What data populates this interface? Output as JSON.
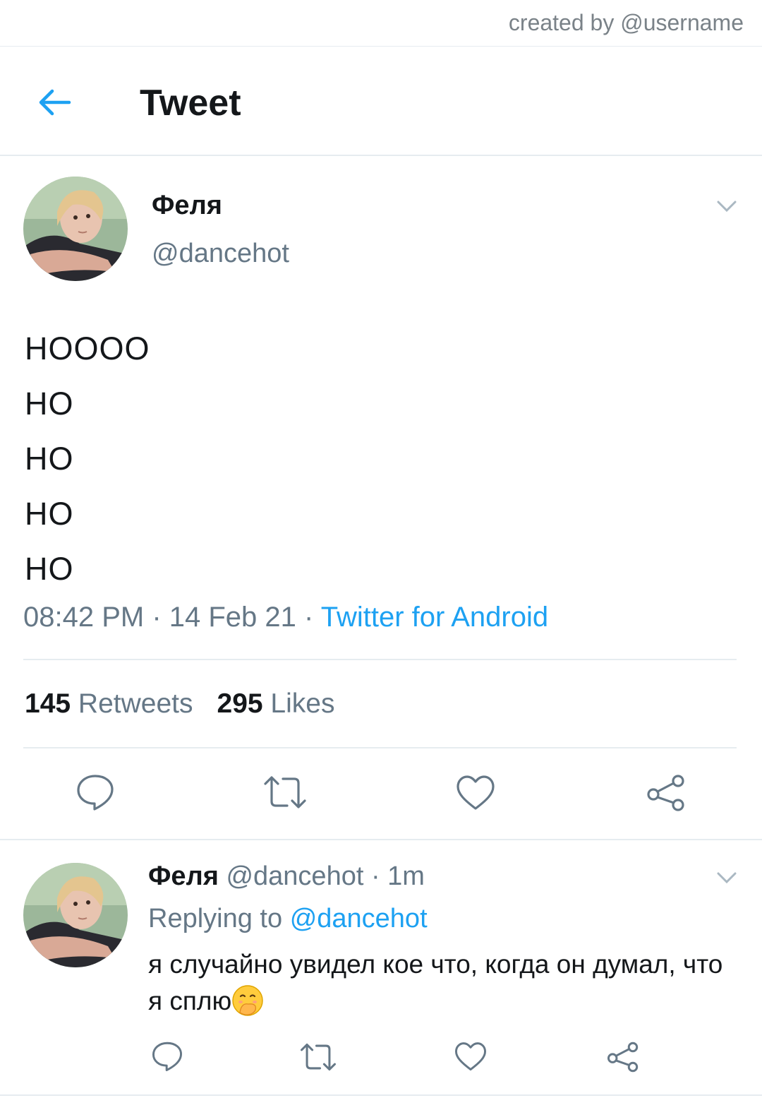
{
  "credit": "created by @username",
  "header": {
    "title": "Tweet",
    "back_icon": "arrow-left-icon",
    "accent": "#1da1f2"
  },
  "tweet": {
    "author_name": "Феля",
    "author_handle": "@dancehot",
    "lines": [
      "HOOOO",
      "HO",
      "HO",
      "HO",
      "HO"
    ],
    "time": "08:42 PM",
    "date": "14 Feb 21",
    "source": "Twitter for Android",
    "sep": " · ",
    "retweets_count": "145",
    "retweets_label": "Retweets",
    "likes_count": "295",
    "likes_label": "Likes",
    "actions": [
      "reply-icon",
      "retweet-icon",
      "like-icon",
      "share-icon"
    ]
  },
  "reply": {
    "author_name": "Феля",
    "author_handle": "@dancehot",
    "sep": " · ",
    "time_ago": "1m",
    "replying_prefix": "Replying to",
    "replying_to": "@dancehot",
    "text": "я случайно увидел кое что, когда он думал, что я сплю",
    "emoji": "face-with-hand-over-mouth",
    "actions": [
      "reply-icon",
      "retweet-icon",
      "like-icon",
      "share-icon"
    ]
  },
  "colors": {
    "text": "#14171a",
    "secondary": "#657786",
    "divider": "#e6ecf0",
    "link": "#1da1f2"
  }
}
